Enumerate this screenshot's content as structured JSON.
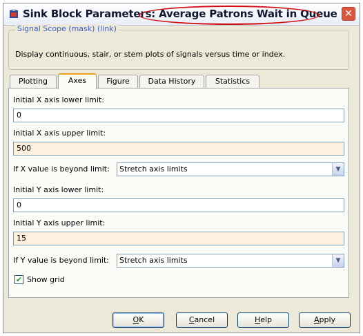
{
  "window": {
    "title": "Sink Block Parameters: Average Patrons Wait in Queue",
    "close_symbol": "✕"
  },
  "mask": {
    "group_label": "Signal Scope (mask) (link)",
    "description": "Display continuous, stair, or stem plots of signals versus time or index."
  },
  "tabs": [
    {
      "label": "Plotting",
      "active": false
    },
    {
      "label": "Axes",
      "active": true
    },
    {
      "label": "Figure",
      "active": false
    },
    {
      "label": "Data History",
      "active": false
    },
    {
      "label": "Statistics",
      "active": false
    }
  ],
  "axes": {
    "x_lower_label": "Initial X axis lower limit:",
    "x_lower_value": "0",
    "x_upper_label": "Initial X axis upper limit:",
    "x_upper_value": "500",
    "x_beyond_label": "If X value is beyond limit:",
    "x_beyond_value": "Stretch axis limits",
    "y_lower_label": "Initial Y axis lower limit:",
    "y_lower_value": "0",
    "y_upper_label": "Initial Y axis upper limit:",
    "y_upper_value": "15",
    "y_beyond_label": "If Y value is beyond limit:",
    "y_beyond_value": "Stretch axis limits",
    "show_grid_label": "Show grid",
    "show_grid_checked": true
  },
  "buttons": {
    "ok": {
      "pre": "",
      "u": "O",
      "post": "K"
    },
    "cancel": {
      "pre": "",
      "u": "C",
      "post": "ancel"
    },
    "help": {
      "pre": "",
      "u": "H",
      "post": "elp"
    },
    "apply": {
      "pre": "",
      "u": "A",
      "post": "pply"
    }
  },
  "colors": {
    "accent_tab": "#f0a21d",
    "modified_field": "#fdf0df",
    "annotation_ellipse": "#d01010",
    "link_text": "#3b5fcf"
  },
  "icons": {
    "app": "simulink-block-icon",
    "close": "close-icon",
    "dropdown": "chevron-down-icon",
    "check": "checkmark-icon"
  }
}
